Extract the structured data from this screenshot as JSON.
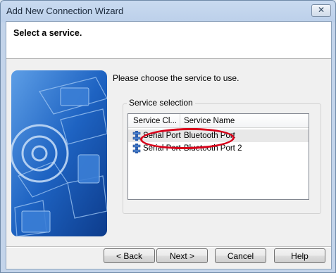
{
  "window": {
    "title": "Add New Connection Wizard",
    "close_glyph": "✕"
  },
  "header": {
    "title": "Select a service."
  },
  "instruction": "Please choose the service to use.",
  "service_selection": {
    "label": "Service selection",
    "columns": [
      "Service Cl...",
      "Service Name"
    ],
    "rows": [
      {
        "class": "Serial Port",
        "name": "Bluetooth Port",
        "icon": "serial-port-icon",
        "selected": true
      },
      {
        "class": "Serial Port",
        "name": "Bluetooth Port 2",
        "icon": "serial-port-icon",
        "selected": false
      }
    ]
  },
  "buttons": {
    "back": "< Back",
    "next": "Next >",
    "cancel": "Cancel",
    "help": "Help"
  },
  "colors": {
    "annotation": "#d8001a",
    "panel_blue": "#1f5fb8"
  }
}
